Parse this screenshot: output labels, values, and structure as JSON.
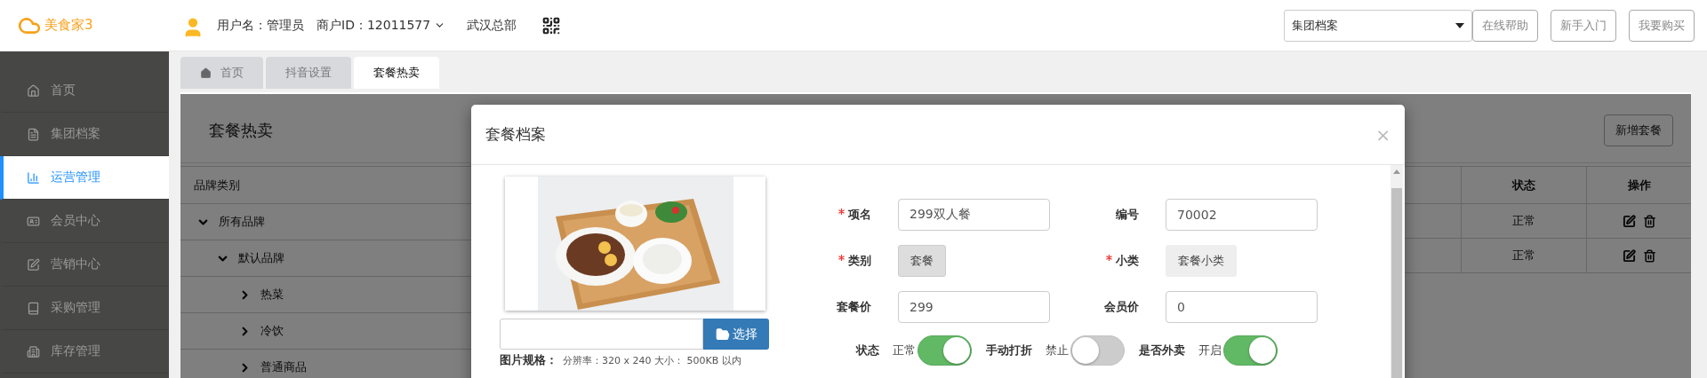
{
  "logo": {
    "text": "美食家3"
  },
  "header": {
    "user": "用户名：管理员",
    "merchant": "商户ID：12011577",
    "store": "武汉总部",
    "dropdown": {
      "value": "集团档案"
    },
    "buttons": [
      "在线帮助",
      "新手入门",
      "我要购买"
    ]
  },
  "sidebar": {
    "items": [
      {
        "label": "首页",
        "selected": false
      },
      {
        "label": "集团档案",
        "selected": false
      },
      {
        "label": "运营管理",
        "selected": true
      },
      {
        "label": "会员中心",
        "selected": false
      },
      {
        "label": "营销中心",
        "selected": false
      },
      {
        "label": "采购管理",
        "selected": false
      },
      {
        "label": "库存管理",
        "selected": false
      }
    ]
  },
  "tabs": [
    {
      "label": "首页",
      "selected": false
    },
    {
      "label": "抖音设置",
      "selected": false
    },
    {
      "label": "套餐热卖",
      "selected": true
    }
  ],
  "page": {
    "title": "套餐热卖",
    "add_button": "新增套餐",
    "tree": {
      "heading": "品牌类别",
      "items": [
        {
          "label": "所有品牌",
          "expanded": true,
          "children": [
            {
              "label": "默认品牌",
              "expanded": true,
              "children": [
                {
                  "label": "热菜",
                  "expanded": false
                },
                {
                  "label": "冷饮",
                  "expanded": false
                },
                {
                  "label": "普通商品",
                  "expanded": false
                }
              ]
            }
          ]
        }
      ]
    },
    "table": {
      "columns": [
        "状态",
        "操作"
      ],
      "rows": [
        {
          "status": "正常"
        },
        {
          "status": "正常"
        }
      ]
    }
  },
  "modal": {
    "title": "套餐档案",
    "close": "×",
    "file_button": "选择",
    "image_spec": {
      "label": "图片规格：",
      "text": "分辨率：320 x 240 大小： 500KB 以内"
    },
    "fields": [
      {
        "label": "项名",
        "required": true,
        "kind": "input",
        "value": "299双人餐"
      },
      {
        "label": "编号",
        "required": false,
        "kind": "input",
        "value": "70002"
      },
      {
        "label": "类别",
        "required": true,
        "kind": "chip",
        "value": "套餐",
        "selected": true
      },
      {
        "label": "小类",
        "required": true,
        "kind": "chip",
        "value": "套餐小类",
        "selected": false
      },
      {
        "label": "套餐价",
        "required": false,
        "kind": "input",
        "value": "299"
      },
      {
        "label": "会员价",
        "required": false,
        "kind": "input",
        "value": "0"
      }
    ],
    "switches": [
      {
        "label": "状态",
        "state_text": "正常",
        "on": true
      },
      {
        "label": "手动打折",
        "state_text": "禁止",
        "on": false
      },
      {
        "label": "是否外卖",
        "state_text": "开启",
        "on": true
      }
    ]
  }
}
